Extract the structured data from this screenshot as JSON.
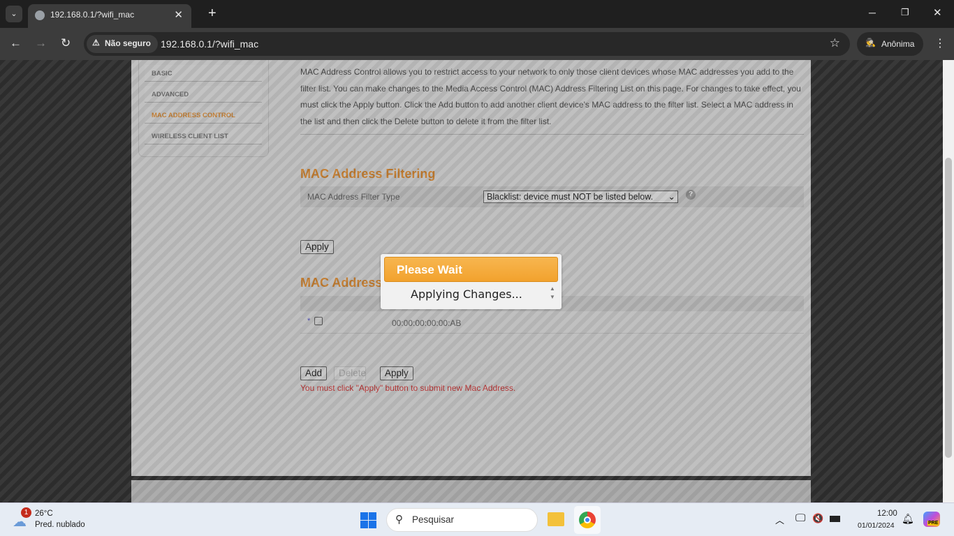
{
  "browser": {
    "tab_title": "192.168.0.1/?wifi_mac",
    "security_label": "Não seguro",
    "url": "192.168.0.1/?wifi_mac",
    "profile_label": "Anônima"
  },
  "sidebar": {
    "items": [
      {
        "label": "BASIC",
        "active": false
      },
      {
        "label": "ADVANCED",
        "active": false
      },
      {
        "label": "MAC ADDRESS CONTROL",
        "active": true
      },
      {
        "label": "WIRELESS CLIENT LIST",
        "active": false
      }
    ]
  },
  "main": {
    "description": "MAC Address Control allows you to restrict access to your network to only those client devices whose MAC addresses you add to the filter list. You can make changes to the Media Access Control (MAC) Address Filtering List on this page. For changes to take effect, you must click the Apply button. Click the Add button to add another client device's MAC address to the filter list. Select a MAC address in the list and then click the Delete button to delete it from the filter list.",
    "filtering_title": "MAC Address Filtering",
    "filter_type_label": "MAC Address Filter Type",
    "filter_type_value": "Blacklist: device must NOT be listed below.",
    "help": "?",
    "apply_label": "Apply",
    "list_title": "MAC Address",
    "entries": [
      {
        "marker": "*",
        "mac": "00:00:00:00:00:AB"
      }
    ],
    "add_label": "Add",
    "delete_label": "Delete",
    "apply2_label": "Apply",
    "warning": "You must click \"Apply\" button to submit new Mac Address."
  },
  "modal": {
    "title": "Please Wait",
    "message": "Applying Changes..."
  },
  "taskbar": {
    "weather_temp": "26°C",
    "weather_desc": "Pred. nublado",
    "weather_badge": "1",
    "search_placeholder": "Pesquisar",
    "time": "12:00",
    "date": "01/01/2024",
    "copilot_badge": "PRE"
  }
}
